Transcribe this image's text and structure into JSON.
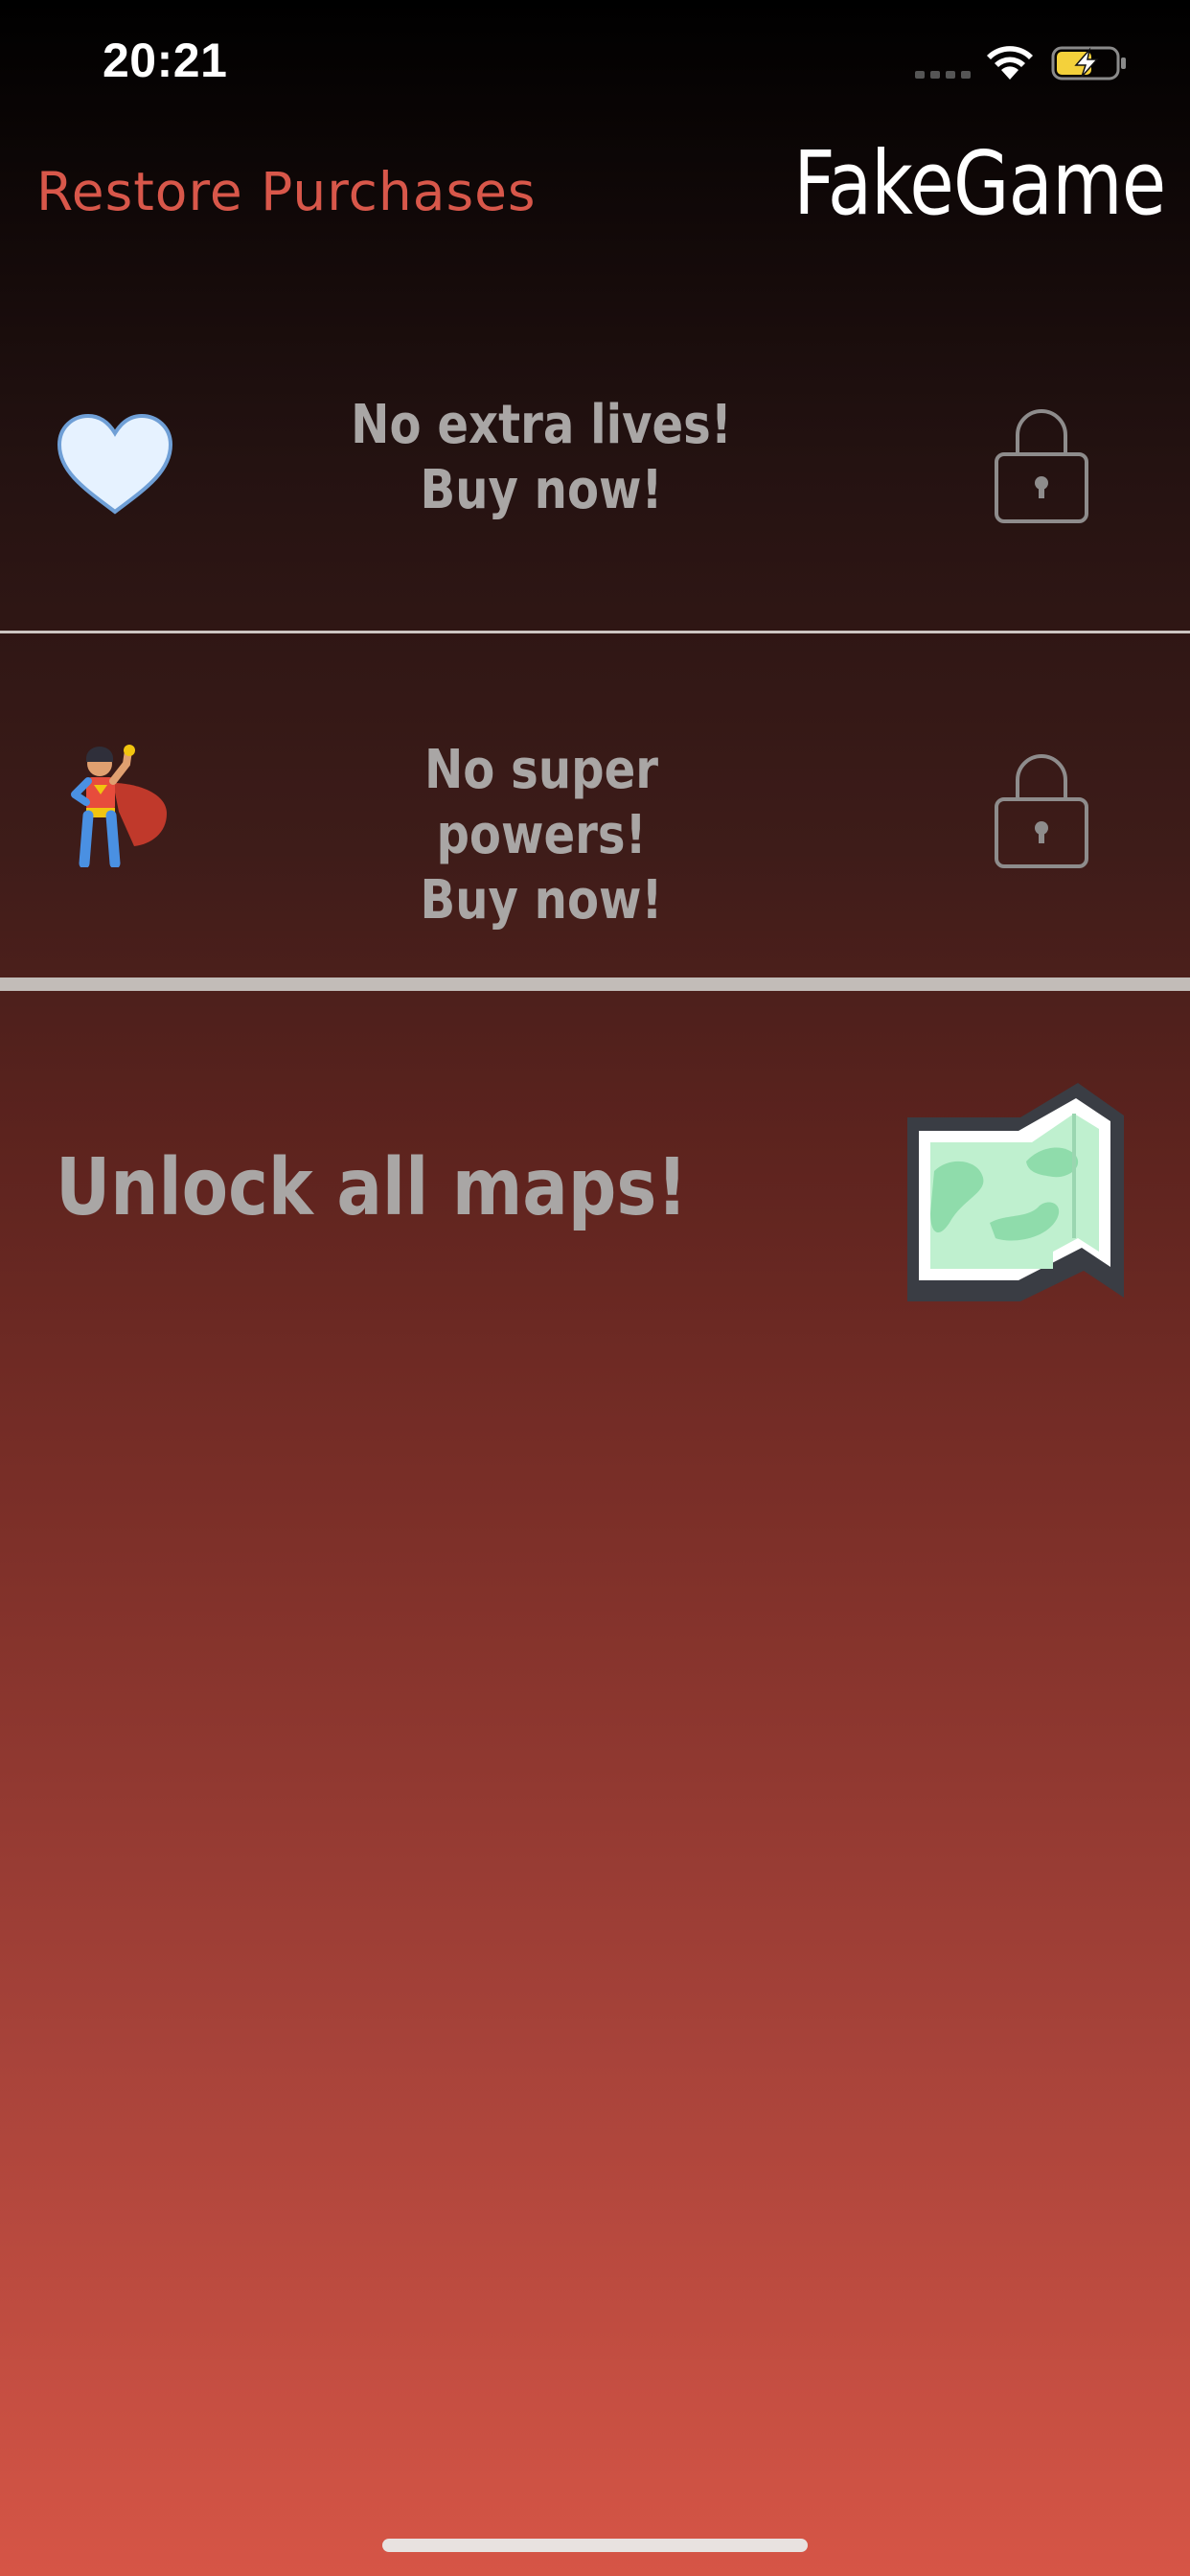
{
  "status_bar": {
    "time": "20:21",
    "signal_icon": "cellular-signal-icon",
    "wifi_icon": "wifi-icon",
    "battery_icon": "battery-charging-icon",
    "battery_color": "#f4d13b"
  },
  "header": {
    "restore_label": "Restore Purchases",
    "app_title": "FakeGame",
    "accent_color": "#d8574a"
  },
  "store_items": [
    {
      "icon": "heart-icon",
      "line1": "No extra lives!",
      "line2": "Buy now!",
      "status_icon": "lock-icon"
    },
    {
      "icon": "superhero-icon",
      "line1": "No super powers!",
      "line2": "Buy now!",
      "status_icon": "lock-icon"
    },
    {
      "icon": "map-icon",
      "line1": "Unlock all maps!"
    }
  ]
}
